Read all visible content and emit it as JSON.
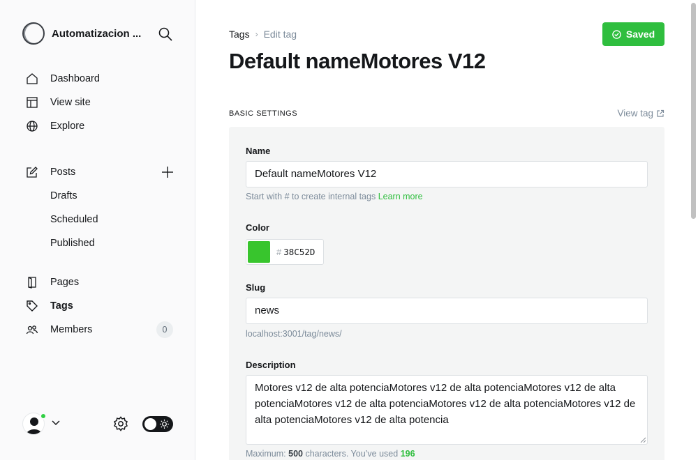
{
  "sidebar": {
    "site_name": "Automatizacion ...",
    "nav_main": [
      {
        "label": "Dashboard",
        "icon": "home-icon"
      },
      {
        "label": "View site",
        "icon": "layout-icon"
      },
      {
        "label": "Explore",
        "icon": "globe-icon"
      }
    ],
    "posts": {
      "label": "Posts",
      "sub": [
        "Drafts",
        "Scheduled",
        "Published"
      ]
    },
    "nav_content": [
      {
        "label": "Pages",
        "icon": "page-icon"
      },
      {
        "label": "Tags",
        "icon": "tag-icon"
      },
      {
        "label": "Members",
        "icon": "members-icon",
        "count": "0"
      }
    ],
    "online_color": "#30cf43"
  },
  "header": {
    "breadcrumb_parent": "Tags",
    "breadcrumb_current": "Edit tag",
    "saved_label": "Saved",
    "title": "Default nameMotores V12"
  },
  "basic": {
    "section_label": "Basic settings",
    "view_tag": "View tag",
    "name_label": "Name",
    "name_value": "Default nameMotores V12",
    "name_hint": "Start with # to create internal tags",
    "learn_more": "Learn more",
    "color_label": "Color",
    "color_hash": "#",
    "color_value": "38C52D",
    "slug_label": "Slug",
    "slug_value": "news",
    "slug_url": "localhost:3001/tag/news/",
    "description_label": "Description",
    "description_value": "Motores v12 de alta potenciaMotores v12 de alta potenciaMotores v12 de alta potenciaMotores v12 de alta potenciaMotores v12 de alta potenciaMotores v12 de alta potenciaMotores v12 de alta potencia",
    "desc_hint_prefix": "Maximum:",
    "desc_max": "500",
    "desc_hint_mid": "characters. You’ve used",
    "desc_used": "196"
  },
  "colors": {
    "accent": "#2fbe3e",
    "tag_color": "#38C52D"
  }
}
